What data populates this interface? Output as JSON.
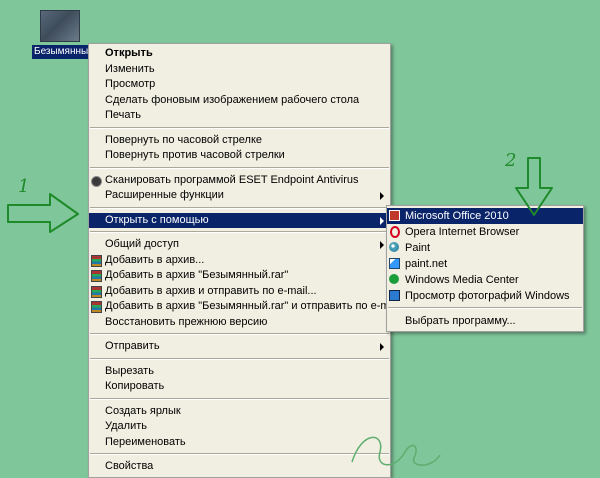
{
  "desktop": {
    "file_label": "Безымянный"
  },
  "context_menu": {
    "items": [
      {
        "label": "Открыть",
        "bold": true
      },
      {
        "label": "Изменить"
      },
      {
        "label": "Просмотр"
      },
      {
        "label": "Сделать фоновым изображением рабочего стола"
      },
      {
        "label": "Печать"
      },
      {
        "label": "Повернуть по часовой стрелке"
      },
      {
        "label": "Повернуть против часовой стрелки"
      },
      {
        "label": "Сканировать программой ESET Endpoint Antivirus",
        "icon": "eset-icon"
      },
      {
        "label": "Расширенные функции",
        "submenu": true
      },
      {
        "label": "Открыть с помощью",
        "submenu": true,
        "highlighted": true
      },
      {
        "label": "Общий доступ",
        "submenu": true
      },
      {
        "label": "Добавить в архив...",
        "icon": "winrar-icon"
      },
      {
        "label": "Добавить в архив \"Безымянный.rar\"",
        "icon": "winrar-icon"
      },
      {
        "label": "Добавить в архив и отправить по e-mail...",
        "icon": "winrar-icon"
      },
      {
        "label": "Добавить в архив \"Безымянный.rar\" и отправить по e-mail",
        "icon": "winrar-icon"
      },
      {
        "label": "Восстановить прежнюю версию"
      },
      {
        "label": "Отправить",
        "submenu": true
      },
      {
        "label": "Вырезать"
      },
      {
        "label": "Копировать"
      },
      {
        "label": "Создать ярлык"
      },
      {
        "label": "Удалить"
      },
      {
        "label": "Переименовать"
      },
      {
        "label": "Свойства"
      }
    ]
  },
  "open_with_submenu": {
    "items": [
      {
        "label": "Microsoft Office 2010",
        "icon": "office-icon",
        "highlighted": true
      },
      {
        "label": "Opera Internet Browser",
        "icon": "opera-icon"
      },
      {
        "label": "Paint",
        "icon": "paint-icon"
      },
      {
        "label": "paint.net",
        "icon": "paintnet-icon"
      },
      {
        "label": "Windows Media Center",
        "icon": "media-center-icon"
      },
      {
        "label": "Просмотр фотографий Windows",
        "icon": "photo-viewer-icon"
      },
      {
        "label": "Выбрать программу..."
      }
    ]
  },
  "annotations": {
    "num1": "1",
    "num2": "2",
    "accent_color": "#1f8a2a",
    "highlight_color": "#0a246a",
    "menu_background": "#f1efe2",
    "desktop_background": "#7fc69a"
  }
}
